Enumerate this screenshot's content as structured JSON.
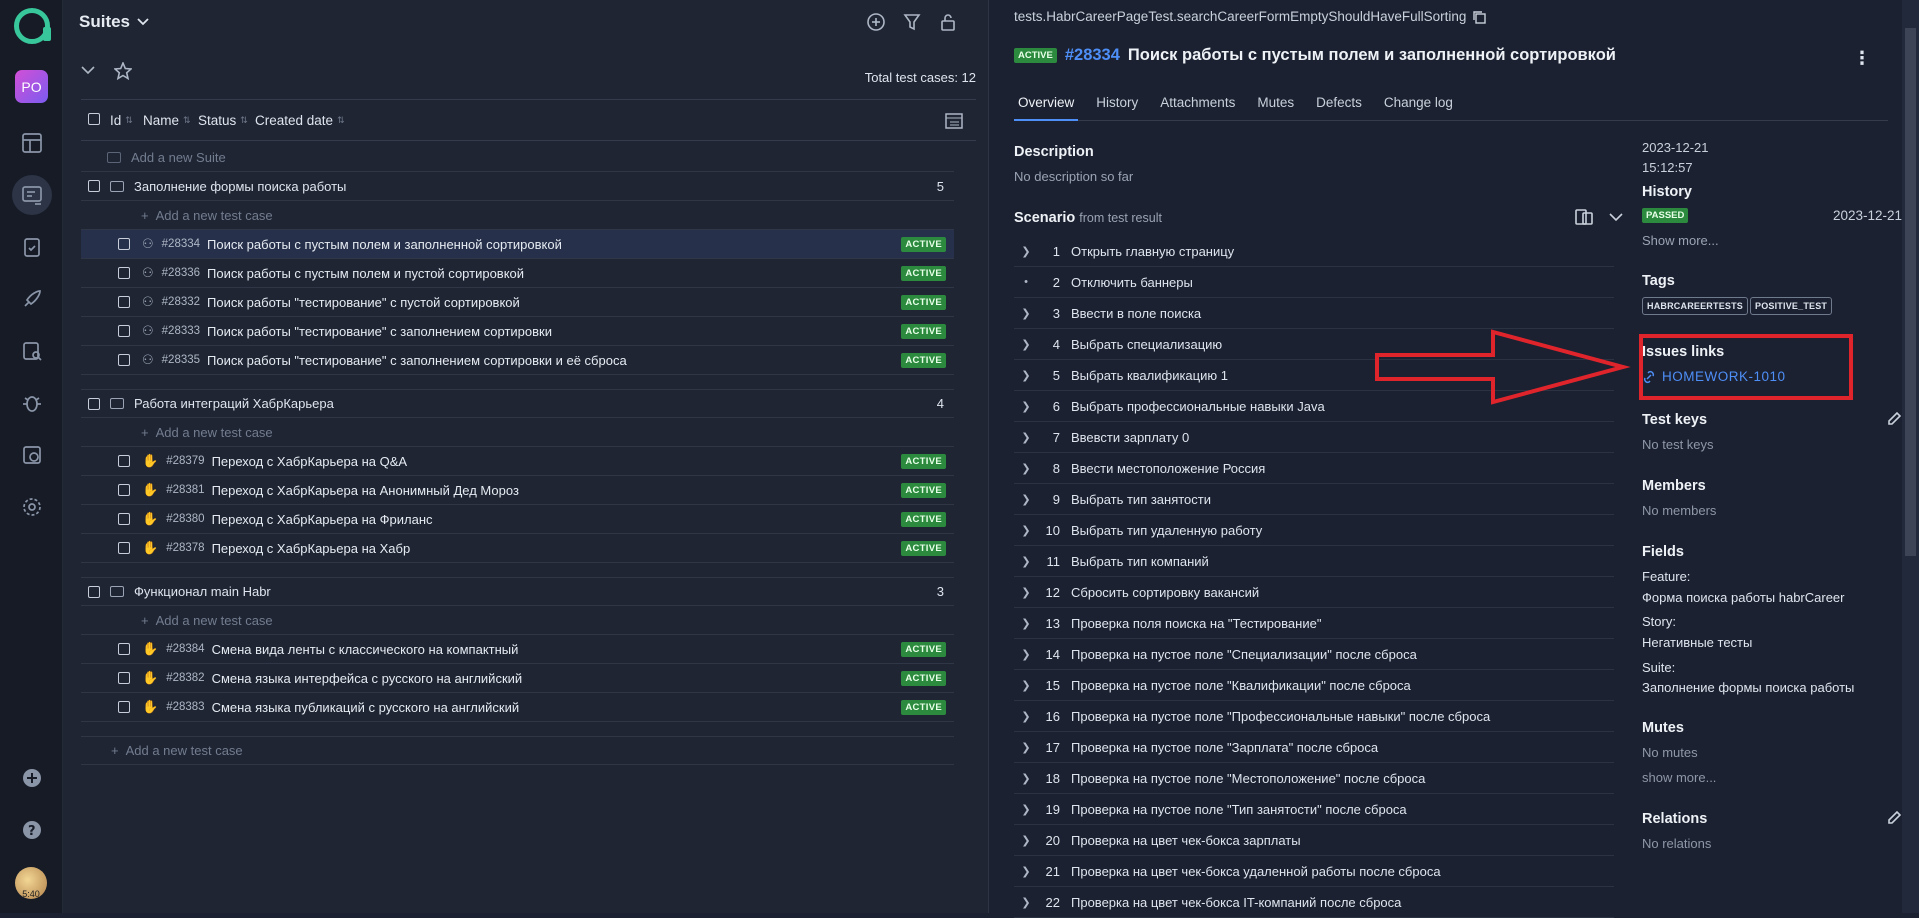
{
  "nav": {
    "project_initials": "PO",
    "items": [
      "dashboard-icon",
      "test-cases-icon",
      "test-plans-icon",
      "launches-icon",
      "search-results-icon",
      "defects-icon",
      "jobs-icon",
      "settings-icon"
    ],
    "bottom": [
      "add-icon",
      "help-icon"
    ],
    "avatar_text": "5:40"
  },
  "left": {
    "title": "Suites",
    "total": "Total test cases: 12",
    "columns": [
      "Id",
      "Name",
      "Status",
      "Created date"
    ],
    "add_suite": "Add a new Suite",
    "add_case": "Add a new test case",
    "active_label": "ACTIVE",
    "suites": [
      {
        "name": "Заполнение формы поиска работы",
        "count": "5",
        "cases": [
          {
            "id": "#28334",
            "name": "Поиск работы с пустым полем и заполненной сортировкой"
          },
          {
            "id": "#28336",
            "name": "Поиск работы с пустым полем и пустой сортировкой"
          },
          {
            "id": "#28332",
            "name": "Поиск работы \"тестирование\" с пустой сортировкой"
          },
          {
            "id": "#28333",
            "name": "Поиск работы \"тестирование\" с заполнением сортировки"
          },
          {
            "id": "#28335",
            "name": "Поиск работы \"тестирование\" с заполнением сортировки и её сброса"
          }
        ]
      },
      {
        "name": "Работа интеграций ХабрКарьера",
        "count": "4",
        "cases": [
          {
            "id": "#28379",
            "name": "Переход с ХабрКарьера на Q&A"
          },
          {
            "id": "#28381",
            "name": "Переход с ХабрКарьера на Анонимный Дед Мороз"
          },
          {
            "id": "#28380",
            "name": "Переход с ХабрКарьера на Фриланс"
          },
          {
            "id": "#28378",
            "name": "Переход с ХабрКарьера на Хабр"
          }
        ]
      },
      {
        "name": "Функционал main Habr",
        "count": "3",
        "cases": [
          {
            "id": "#28384",
            "name": "Смена вида ленты с классического на компактный"
          },
          {
            "id": "#28382",
            "name": "Смена языка интерфейса с русского на английский"
          },
          {
            "id": "#28383",
            "name": "Смена языка публикаций с русского на английский"
          }
        ]
      }
    ]
  },
  "right": {
    "path": "tests.HabrCareerPageTest.searchCareerFormEmptyShouldHaveFullSorting",
    "status": "ACTIVE",
    "number": "#28334",
    "title": "Поиск работы с пустым полем и заполненной сортировкой",
    "tabs": [
      "Overview",
      "History",
      "Attachments",
      "Mutes",
      "Defects",
      "Change log"
    ],
    "description_h": "Description",
    "description_t": "No description so far",
    "scenario_h": "Scenario",
    "scenario_sub": "from test result",
    "steps": [
      "Открыть главную страницу",
      "Отключить баннеры",
      "Ввести в поле поиска",
      "Выбрать специализацию",
      "Выбрать квалификацию 1",
      "Выбрать профессиональные навыки Java",
      "Ввевсти зарплату 0",
      "Ввести местоположение Россия",
      "Выбрать тип занятости",
      "Выбрать тип удаленную работу",
      "Выбрать тип компаний",
      "Сбросить сортировку вакансий",
      "Проверка поля поиска на \"Тестирование\"",
      "Проверка на пустое поле \"Специализации\" после сброса",
      "Проверка на пустое поле \"Квалификации\" после сброса",
      "Проверка на пустое поле \"Профессиональные навыки\" после сброса",
      "Проверка на пустое поле \"Зарплата\" после сброса",
      "Проверка на пустое поле \"Местоположение\" после сброса",
      "Проверка на пустое поле \"Тип занятости\" после сброса",
      "Проверка на цвет чек-бокса зарплаты",
      "Проверка на цвет чек-бокса удаленной работы после сброса",
      "Проверка на цвет чек-бокса IT-компаний после сброса"
    ],
    "side": {
      "created_date": "2023-12-21",
      "created_time": "15:12:57",
      "history_h": "History",
      "history_status": "PASSED",
      "history_date": "2023-12-21",
      "show_more": "Show more...",
      "tags_h": "Tags",
      "tags": [
        "HABRCAREERTESTS",
        "POSITIVE_TEST"
      ],
      "issues_h": "Issues links",
      "issue": "HOMEWORK-1010",
      "keys_h": "Test keys",
      "keys_t": "No test keys",
      "members_h": "Members",
      "members_t": "No members",
      "fields_h": "Fields",
      "feature_l": "Feature:",
      "feature_v": "Форма поиска работы habrCareer",
      "story_l": "Story:",
      "story_v": "Негативные тесты",
      "suite_l": "Suite:",
      "suite_v": "Заполнение формы поиска работы",
      "mutes_h": "Mutes",
      "mutes_t": "No mutes",
      "mutes_more": "show more...",
      "relations_h": "Relations",
      "relations_t": "No relations"
    }
  },
  "colors": {
    "accent": "#4e8ef7",
    "active": "#2b8a3e",
    "annotation": "#e0242c"
  }
}
